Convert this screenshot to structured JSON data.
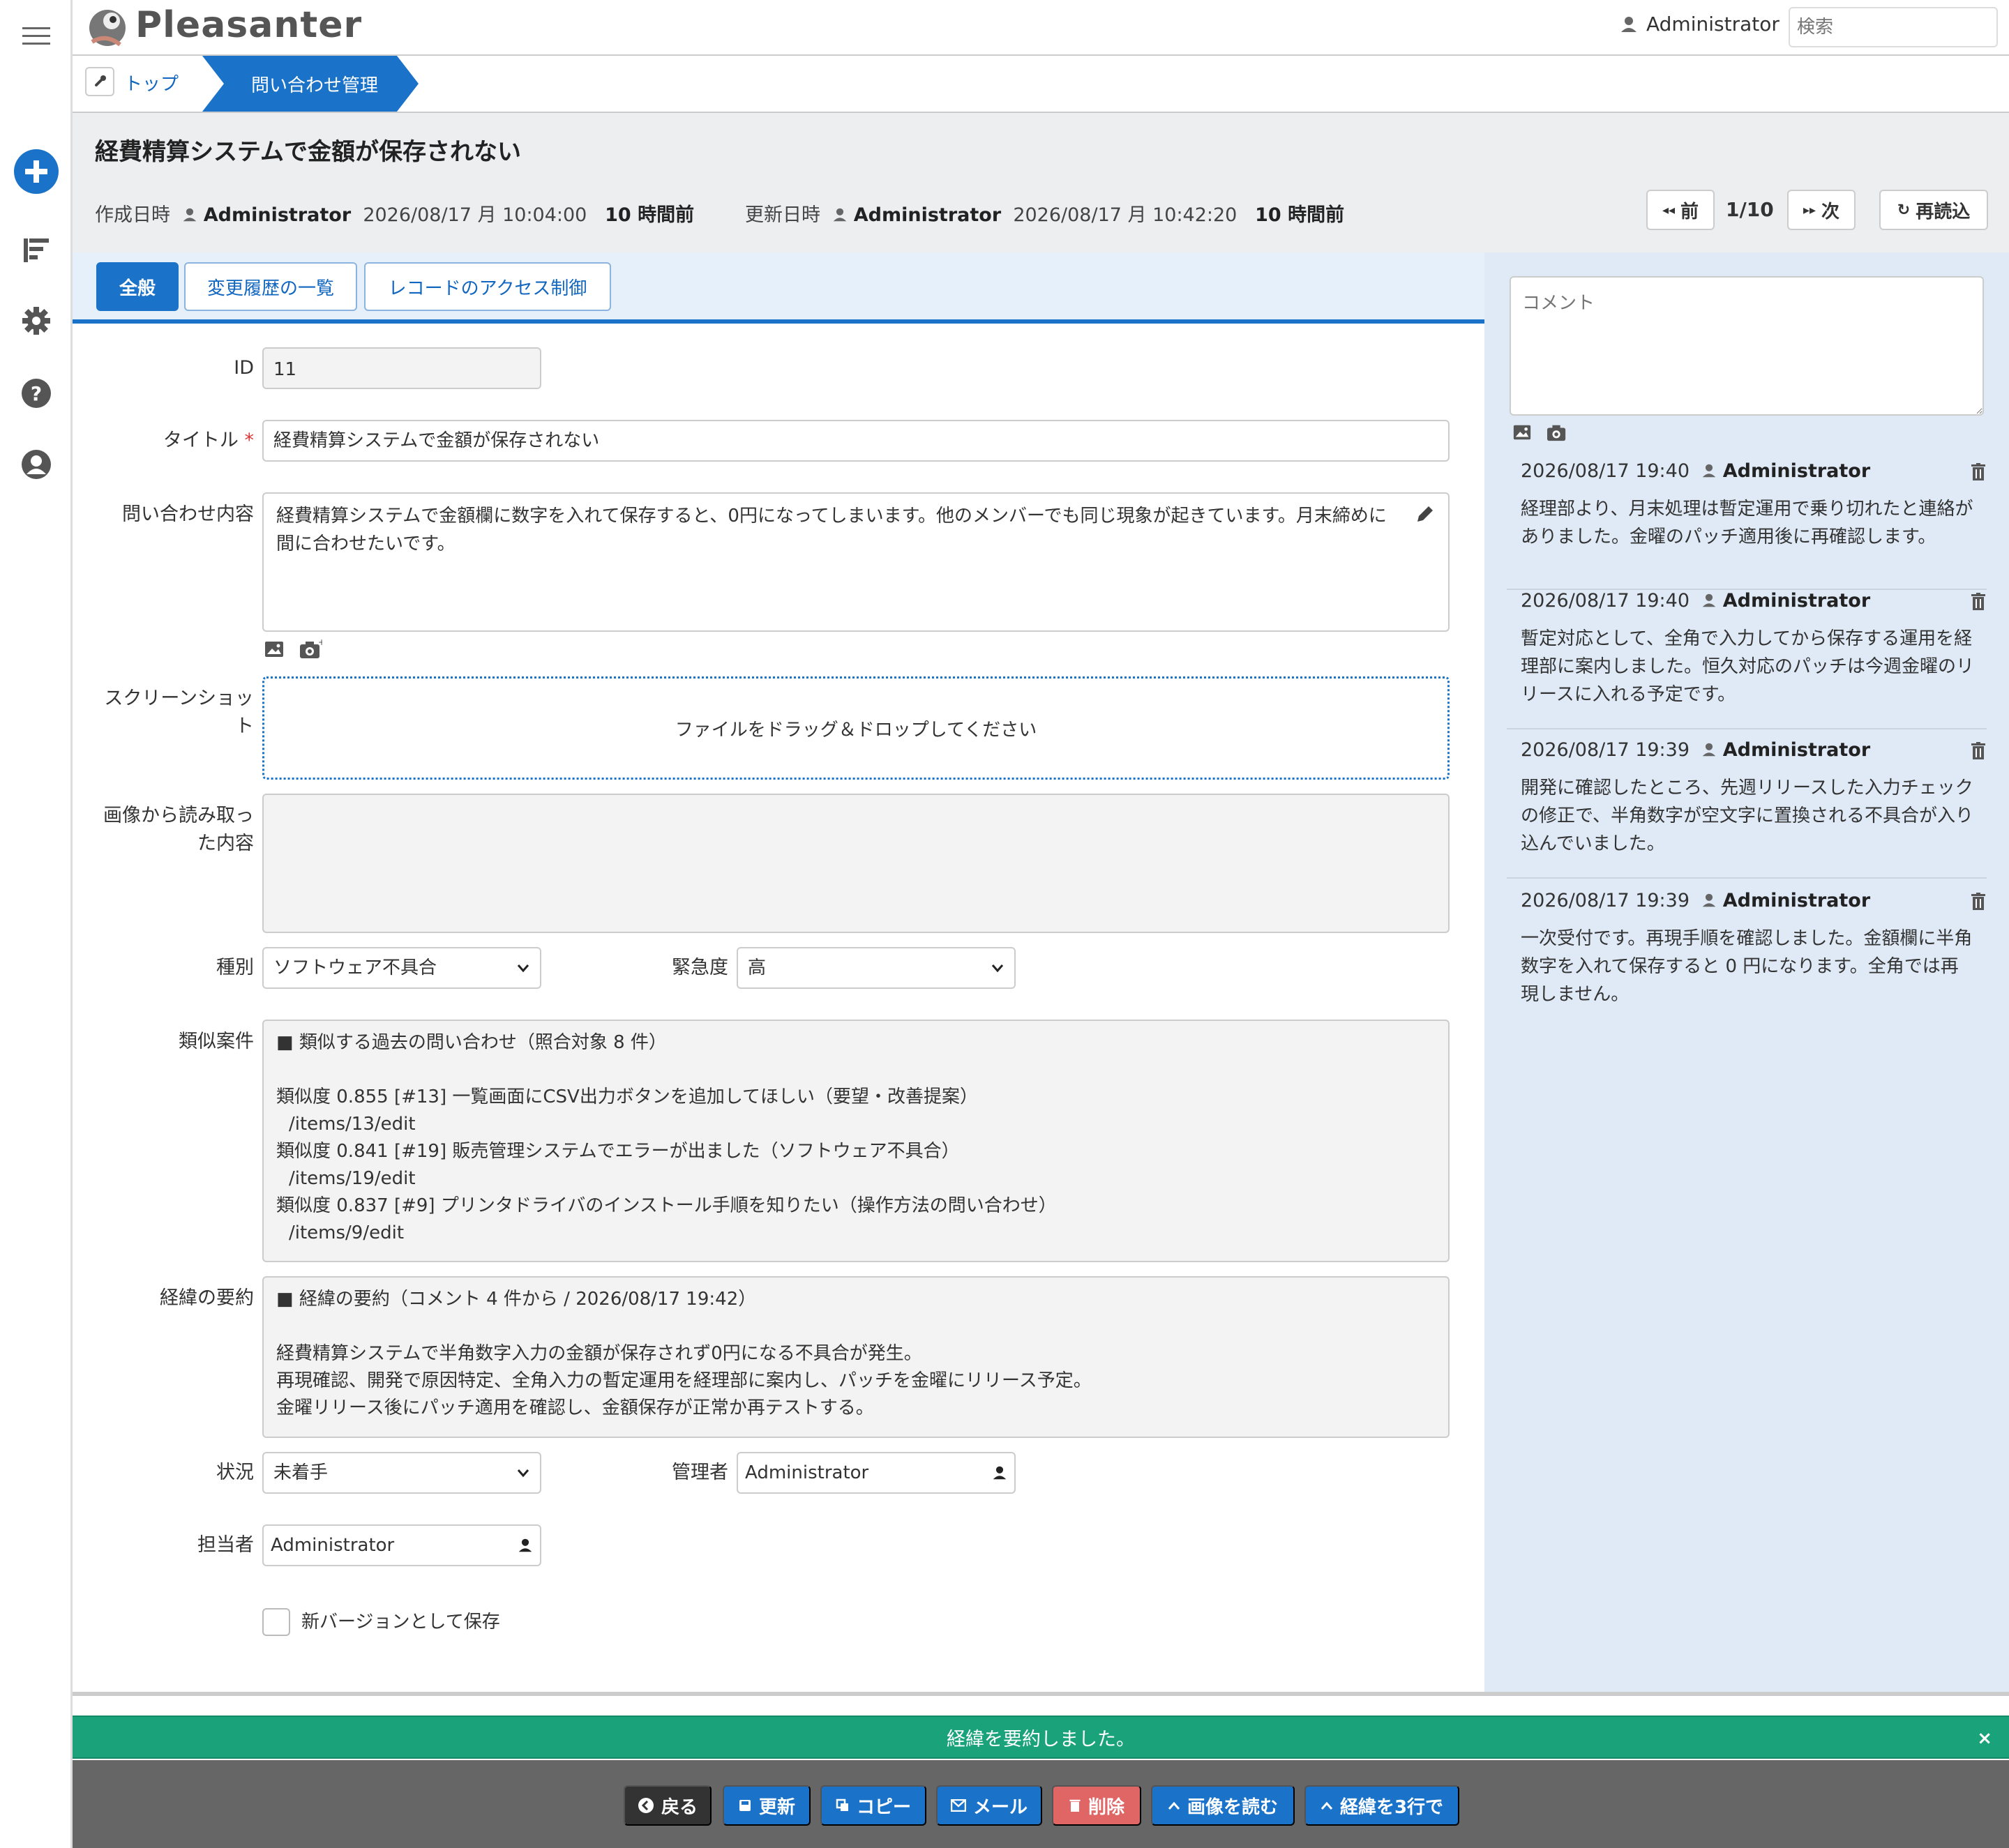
{
  "app": {
    "logo_text": "Pleasanter"
  },
  "header": {
    "user_name": "Administrator",
    "search_placeholder": "検索"
  },
  "breadcrumb": {
    "top": "トップ",
    "current": "問い合わせ管理"
  },
  "record": {
    "title": "経費精算システムで金額が保存されない",
    "created_label": "作成日時",
    "created_user": "Administrator",
    "created_at": "2026/08/17 月 10:04:00",
    "created_ago": "10 時間前",
    "updated_label": "更新日時",
    "updated_user": "Administrator",
    "updated_at": "2026/08/17 月 10:42:20",
    "updated_ago": "10 時間前"
  },
  "pager": {
    "prev": "前",
    "position": "1/10",
    "next": "次",
    "reload": "再読込"
  },
  "tabs": [
    {
      "label": "全般",
      "active": true
    },
    {
      "label": "変更履歴の一覧",
      "active": false
    },
    {
      "label": "レコードのアクセス制御",
      "active": false
    }
  ],
  "form": {
    "id_label": "ID",
    "id_value": "11",
    "title_label": "タイトル",
    "title_required": "*",
    "title_value": "経費精算システムで金額が保存されない",
    "body_label": "問い合わせ内容",
    "body_value": "経費精算システムで金額欄に数字を入れて保存すると、0円になってしまいます。他のメンバーでも同じ現象が起きています。月末締めに間に合わせたいです。",
    "screenshot_label_1": "スクリーンショッ",
    "screenshot_label_2": "ト",
    "dropzone_text": "ファイルをドラッグ＆ドロップしてください",
    "ocr_label_1": "画像から読み取っ",
    "ocr_label_2": "た内容",
    "ocr_value": "",
    "type_label": "種別",
    "type_value": "ソフトウェア不具合",
    "urgency_label": "緊急度",
    "urgency_value": "高",
    "similar_label": "類似案件",
    "similar_heading": "■ 類似する過去の問い合わせ（照合対象 8 件）",
    "similar_items": [
      {
        "line": "類似度 0.855 [#13] 一覧画面にCSV出力ボタンを追加してほしい（要望・改善提案）",
        "path": "/items/13/edit"
      },
      {
        "line": "類似度 0.841 [#19] 販売管理システムでエラーが出ました（ソフトウェア不具合）",
        "path": "/items/19/edit"
      },
      {
        "line": "類似度 0.837 [#9] プリンタドライバのインストール手順を知りたい（操作方法の問い合わせ）",
        "path": "/items/9/edit"
      }
    ],
    "summary_label": "経緯の要約",
    "summary_heading": "■ 経緯の要約（コメント 4 件から / 2026/08/17 19:42）",
    "summary_lines": [
      "経費精算システムで半角数字入力の金額が保存されず0円になる不具合が発生。",
      "再現確認、開発で原因特定、全角入力の暫定運用を経理部に案内し、パッチを金曜にリリース予定。",
      "金曜リリース後にパッチ適用を確認し、金額保存が正常か再テストする。"
    ],
    "status_label": "状況",
    "status_value": "未着手",
    "manager_label": "管理者",
    "manager_value": "Administrator",
    "owner_label": "担当者",
    "owner_value": "Administrator",
    "new_version_label": "新バージョンとして保存"
  },
  "comments": {
    "placeholder": "コメント",
    "items": [
      {
        "time": "2026/08/17 19:40",
        "user": "Administrator",
        "body": "経理部より、月末処理は暫定運用で乗り切れたと連絡がありました。金曜のパッチ適用後に再確認します。"
      },
      {
        "time": "2026/08/17 19:40",
        "user": "Administrator",
        "body": "暫定対応として、全角で入力してから保存する運用を経理部に案内しました。恒久対応のパッチは今週金曜のリリースに入れる予定です。"
      },
      {
        "time": "2026/08/17 19:39",
        "user": "Administrator",
        "body": "開発に確認したところ、先週リリースした入力チェックの修正で、半角数字が空文字に置換される不具合が入り込んでいました。"
      },
      {
        "time": "2026/08/17 19:39",
        "user": "Administrator",
        "body": "一次受付です。再現手順を確認しました。金額欄に半角数字を入れて保存すると 0 円になります。全角では再現しません。"
      }
    ]
  },
  "message": {
    "text": "経緯を要約しました。",
    "close": "×"
  },
  "actions": {
    "back": "戻る",
    "update": "更新",
    "copy": "コピー",
    "mail": "メール",
    "delete": "削除",
    "read_image": "画像を読む",
    "summarize": "経緯を3行で"
  },
  "colors": {
    "accent": "#1a73c9",
    "success": "#1aa37a",
    "danger": "#e06666",
    "dark": "#333333"
  }
}
